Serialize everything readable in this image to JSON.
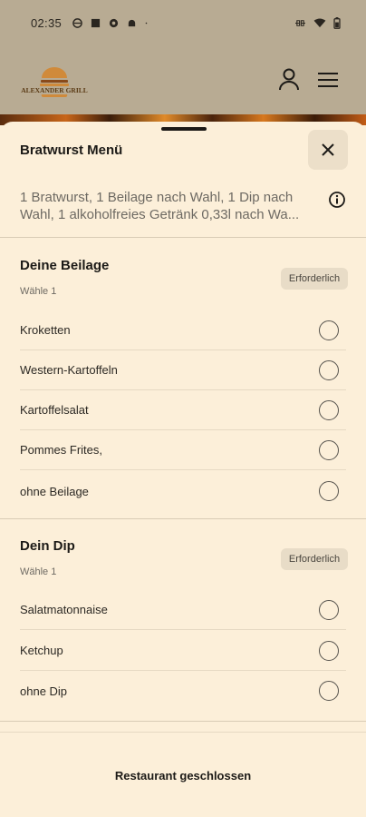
{
  "status_bar": {
    "time": "02:35",
    "left_icons": [
      "circle-app-icon",
      "square-app-icon",
      "settings-app-icon",
      "android-icon",
      "dot-icon"
    ],
    "right_icons": [
      "link-icon",
      "wifi-icon",
      "battery-icon"
    ]
  },
  "header": {
    "logo_text": "ALEXANDER GRILL",
    "user_icon": "user-icon",
    "menu_icon": "menu-icon"
  },
  "sheet": {
    "title": "Bratwurst Menü",
    "close_icon": "close-icon",
    "description": "1 Bratwurst, 1 Beilage nach Wahl, 1 Dip nach Wahl, 1 alkoholfreies Getränk 0,33l nach Wa...",
    "info_icon": "info-icon"
  },
  "groups": [
    {
      "title": "Deine Beilage",
      "subtitle": "Wähle 1",
      "badge": "Erforderlich",
      "options": [
        "Kroketten",
        "Western-Kartoffeln",
        "Kartoffelsalat",
        "Pommes Frites,",
        "ohne Beilage"
      ]
    },
    {
      "title": "Dein Dip",
      "subtitle": "Wähle 1",
      "badge": "Erforderlich",
      "options": [
        "Salatmatonnaise",
        "Ketchup",
        "ohne Dip"
      ]
    }
  ],
  "footer": {
    "status_text": "Restaurant geschlossen"
  },
  "colors": {
    "background": "#fcefd9",
    "header_bg": "#b8ab93",
    "badge_bg": "#e8dcc7",
    "close_bg": "#ecdfc9",
    "text": "#1c1a17",
    "muted_text": "#6e6a63"
  }
}
